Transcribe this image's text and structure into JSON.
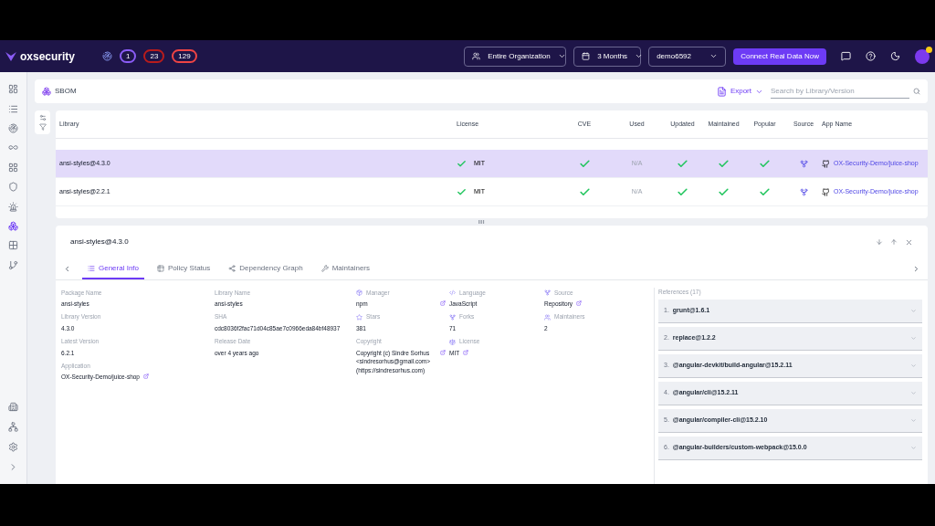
{
  "topbar": {
    "logo": "oxsecurity",
    "badges": [
      {
        "count": "1",
        "color": "#8b5cf6"
      },
      {
        "count": "23",
        "color": "#b91c1c"
      },
      {
        "count": "129",
        "color": "#ef4444"
      }
    ],
    "filters": [
      {
        "kind": "org",
        "value": "Entire Organization"
      },
      {
        "kind": "date",
        "value": "3 Months"
      },
      {
        "kind": "plain",
        "value": "demo6592"
      }
    ],
    "cta": "Connect Real Data Now"
  },
  "sidebar": {
    "items": [
      {
        "selected": false
      },
      {
        "selected": false
      },
      {
        "selected": false
      },
      {
        "selected": false
      },
      {
        "selected": false
      },
      {
        "selected": false
      },
      {
        "selected": false
      },
      {
        "selected": true
      },
      {
        "selected": false
      },
      {
        "selected": false
      }
    ],
    "bottom_items": [
      {
        "selected": false
      },
      {
        "selected": false
      },
      {
        "selected": false
      },
      {
        "selected": false
      }
    ]
  },
  "page": {
    "title": "SBOM",
    "export": "Export",
    "search": {
      "placeholder": "Search by Library/Version"
    }
  },
  "table": {
    "columns": [
      "Library",
      "License",
      "CVE",
      "Used",
      "Updated",
      "Maintained",
      "Popular",
      "Source",
      "App Name"
    ],
    "rows": [
      {
        "library": "ansi-styles@4.3.0",
        "license": "MIT",
        "cve": true,
        "used": "N/A",
        "updated": true,
        "maintained": true,
        "popular": true,
        "app": "OX-Security-Demo/juice-shop",
        "selected": true
      },
      {
        "library": "ansi-styles@2.2.1",
        "license": "MIT",
        "cve": true,
        "used": "N/A",
        "updated": true,
        "maintained": true,
        "popular": true,
        "app": "OX-Security-Demo/juice-shop",
        "selected": false
      }
    ]
  },
  "detail": {
    "title": "ansi-styles@4.3.0",
    "tabs": [
      {
        "label": "General Info",
        "selected": true
      },
      {
        "label": "Policy Status",
        "selected": false
      },
      {
        "label": "Dependency Graph",
        "selected": false
      },
      {
        "label": "Maintainers",
        "selected": false
      }
    ],
    "columns": [
      [
        {
          "label": "Package Name",
          "value": "ansi-styles"
        },
        {
          "label": "Library Version",
          "value": "4.3.0"
        },
        {
          "label": "Latest Version",
          "value": "6.2.1"
        },
        {
          "label": "Application",
          "value": "OX-Security-Demo/juice-shop",
          "link": true
        }
      ],
      [
        {
          "label": "Library Name",
          "value": "ansi-styles"
        },
        {
          "label": "SHA",
          "value": "cdc8036f2fac71d04c85ae7c0966eda84bf48937"
        },
        {
          "label": "Release Date",
          "value": "over 4 years ago"
        }
      ],
      [
        {
          "label": "Manager",
          "value": "npm",
          "link": true
        },
        {
          "label": "Stars",
          "value": "381"
        },
        {
          "label": "Copyright",
          "value": "Copyright (c) Sindre Sorhus <sindresorhus@gmail.com> (https://sindresorhus.com)",
          "link": true
        }
      ],
      [
        {
          "label": "Language",
          "value": "JavaScript"
        },
        {
          "label": "Forks",
          "value": "71"
        },
        {
          "label": "License",
          "value": "MIT",
          "link": true
        }
      ],
      [
        {
          "label": "Source",
          "value": "Repository",
          "link": true
        },
        {
          "label": "Maintainers",
          "value": "2"
        }
      ]
    ],
    "references": {
      "title": "References (17)",
      "items": [
        {
          "index": "1.",
          "name": "grunt@1.6.1"
        },
        {
          "index": "2.",
          "name": "replace@1.2.2"
        },
        {
          "index": "3.",
          "name": "@angular-devkit/build-angular@15.2.11"
        },
        {
          "index": "4.",
          "name": "@angular/cli@15.2.11"
        },
        {
          "index": "5.",
          "name": "@angular/compiler-cli@15.2.10"
        },
        {
          "index": "6.",
          "name": "@angular-builders/custom-webpack@15.0.0"
        }
      ]
    }
  }
}
